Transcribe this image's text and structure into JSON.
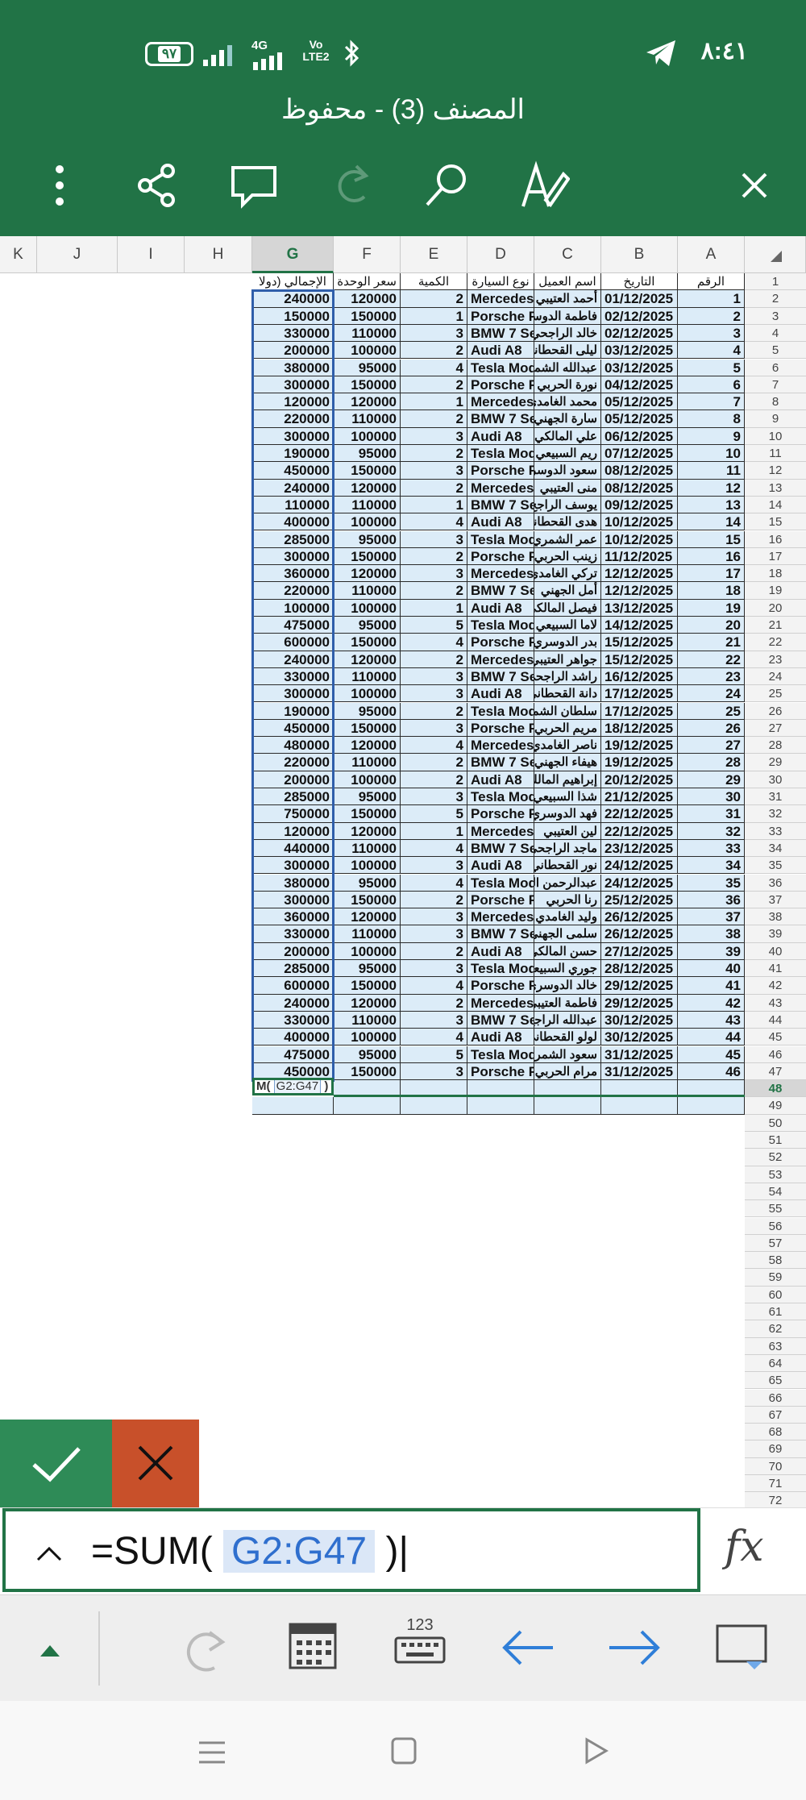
{
  "status_bar": {
    "time": "٨:٤١",
    "battery": "٩٧",
    "network": "4G",
    "volte": "Vo LTE2"
  },
  "header": {
    "title": "المصنف (3) - محفوظ"
  },
  "columns": [
    "K",
    "J",
    "I",
    "H",
    "G",
    "F",
    "E",
    "D",
    "C",
    "B",
    "A"
  ],
  "selected_column": "G",
  "headers": {
    "A": "الرقم",
    "B": "التاريخ",
    "C": "اسم العميل",
    "D": "نوع السيارة",
    "E": "الكمية",
    "F": "سعر الوحدة (",
    "G": "الإجمالي (دولا"
  },
  "rows": [
    [
      "1",
      "01/12/2025",
      "أحمد العتيبي",
      "Mercedes",
      "2",
      "120000",
      "240000"
    ],
    [
      "2",
      "02/12/2025",
      "فاطمة الدوسر",
      "Porsche F",
      "1",
      "150000",
      "150000"
    ],
    [
      "3",
      "02/12/2025",
      "خالد الراجحي",
      "BMW 7 Se",
      "3",
      "110000",
      "330000"
    ],
    [
      "4",
      "03/12/2025",
      "ليلى القحطاني",
      "Audi A8",
      "2",
      "100000",
      "200000"
    ],
    [
      "5",
      "03/12/2025",
      "عبدالله الشمر",
      "Tesla Mod",
      "4",
      "95000",
      "380000"
    ],
    [
      "6",
      "04/12/2025",
      "نورة الحربي",
      "Porsche F",
      "2",
      "150000",
      "300000"
    ],
    [
      "7",
      "05/12/2025",
      "محمد الغامدي",
      "Mercedes",
      "1",
      "120000",
      "120000"
    ],
    [
      "8",
      "05/12/2025",
      "سارة الجهني",
      "BMW 7 Se",
      "2",
      "110000",
      "220000"
    ],
    [
      "9",
      "06/12/2025",
      "علي المالكي",
      "Audi A8",
      "3",
      "100000",
      "300000"
    ],
    [
      "10",
      "07/12/2025",
      "ريم السبيعي",
      "Tesla Mod",
      "2",
      "95000",
      "190000"
    ],
    [
      "11",
      "08/12/2025",
      "سعود الدوسر",
      "Porsche F",
      "3",
      "150000",
      "450000"
    ],
    [
      "12",
      "08/12/2025",
      "منى العتيبي",
      "Mercedes",
      "2",
      "120000",
      "240000"
    ],
    [
      "13",
      "09/12/2025",
      "يوسف الراجح",
      "BMW 7 Se",
      "1",
      "110000",
      "110000"
    ],
    [
      "14",
      "10/12/2025",
      "هدى القحطاني",
      "Audi A8",
      "4",
      "100000",
      "400000"
    ],
    [
      "15",
      "10/12/2025",
      "عمر الشمري",
      "Tesla Mod",
      "3",
      "95000",
      "285000"
    ],
    [
      "16",
      "11/12/2025",
      "زينب الحربي",
      "Porsche F",
      "2",
      "150000",
      "300000"
    ],
    [
      "17",
      "12/12/2025",
      "تركي الغامدي",
      "Mercedes",
      "3",
      "120000",
      "360000"
    ],
    [
      "18",
      "12/12/2025",
      "أمل الجهني",
      "BMW 7 Se",
      "2",
      "110000",
      "220000"
    ],
    [
      "19",
      "13/12/2025",
      "فيصل المالكي",
      "Audi A8",
      "1",
      "100000",
      "100000"
    ],
    [
      "20",
      "14/12/2025",
      "لاما السبيعي",
      "Tesla Mod",
      "5",
      "95000",
      "475000"
    ],
    [
      "21",
      "15/12/2025",
      "بدر الدوسري",
      "Porsche F",
      "4",
      "150000",
      "600000"
    ],
    [
      "22",
      "15/12/2025",
      "جواهر العتيبي",
      "Mercedes",
      "2",
      "120000",
      "240000"
    ],
    [
      "23",
      "16/12/2025",
      "راشد الراجحي",
      "BMW 7 Se",
      "3",
      "110000",
      "330000"
    ],
    [
      "24",
      "17/12/2025",
      "دانة القحطاني",
      "Audi A8",
      "3",
      "100000",
      "300000"
    ],
    [
      "25",
      "17/12/2025",
      "سلطان الشمر",
      "Tesla Mod",
      "2",
      "95000",
      "190000"
    ],
    [
      "26",
      "18/12/2025",
      "مريم الحربي",
      "Porsche F",
      "3",
      "150000",
      "450000"
    ],
    [
      "27",
      "19/12/2025",
      "ناصر الغامدي",
      "Mercedes",
      "4",
      "120000",
      "480000"
    ],
    [
      "28",
      "19/12/2025",
      "هيفاء الجهني",
      "BMW 7 Se",
      "2",
      "110000",
      "220000"
    ],
    [
      "29",
      "20/12/2025",
      "إبراهيم المالك",
      "Audi A8",
      "2",
      "100000",
      "200000"
    ],
    [
      "30",
      "21/12/2025",
      "شذا السبيعي",
      "Tesla Mod",
      "3",
      "95000",
      "285000"
    ],
    [
      "31",
      "22/12/2025",
      "فهد الدوسري",
      "Porsche F",
      "5",
      "150000",
      "750000"
    ],
    [
      "32",
      "22/12/2025",
      "لين العتيبي",
      "Mercedes",
      "1",
      "120000",
      "120000"
    ],
    [
      "33",
      "23/12/2025",
      "ماجد الراجحي",
      "BMW 7 Se",
      "4",
      "110000",
      "440000"
    ],
    [
      "34",
      "24/12/2025",
      "نور القحطاني",
      "Audi A8",
      "3",
      "100000",
      "300000"
    ],
    [
      "35",
      "24/12/2025",
      "عبدالرحمن الش",
      "Tesla Mod",
      "4",
      "95000",
      "380000"
    ],
    [
      "36",
      "25/12/2025",
      "رنا الحربي",
      "Porsche F",
      "2",
      "150000",
      "300000"
    ],
    [
      "37",
      "26/12/2025",
      "وليد الغامدي",
      "Mercedes",
      "3",
      "120000",
      "360000"
    ],
    [
      "38",
      "26/12/2025",
      "سلمى الجهني",
      "BMW 7 Se",
      "3",
      "110000",
      "330000"
    ],
    [
      "39",
      "27/12/2025",
      "حسن المالكي",
      "Audi A8",
      "2",
      "100000",
      "200000"
    ],
    [
      "40",
      "28/12/2025",
      "جوري السبيعي",
      "Tesla Mod",
      "3",
      "95000",
      "285000"
    ],
    [
      "41",
      "29/12/2025",
      "خالد الدوسري",
      "Porsche F",
      "4",
      "150000",
      "600000"
    ],
    [
      "42",
      "29/12/2025",
      "فاطمة العتيبي",
      "Mercedes",
      "2",
      "120000",
      "240000"
    ],
    [
      "43",
      "30/12/2025",
      "عبدالله الراجح",
      "BMW 7 Se",
      "3",
      "110000",
      "330000"
    ],
    [
      "44",
      "30/12/2025",
      "لولو القحطاني",
      "Audi A8",
      "4",
      "100000",
      "400000"
    ],
    [
      "45",
      "31/12/2025",
      "سعود الشمري",
      "Tesla Mod",
      "5",
      "95000",
      "475000"
    ],
    [
      "46",
      "31/12/2025",
      "مرام الحربي",
      "Porsche F",
      "3",
      "150000",
      "450000"
    ]
  ],
  "row_numbers_extra": [
    "48",
    "49",
    "50",
    "51",
    "52",
    "53",
    "54",
    "55",
    "56",
    "57",
    "58",
    "59",
    "60",
    "61",
    "62",
    "63",
    "64",
    "65",
    "66",
    "67",
    "68",
    "69",
    "70",
    "71",
    "72"
  ],
  "editing_cell": {
    "prefix": "M(",
    "ref": "G2:G47",
    "suffix": ")"
  },
  "formula_bar": {
    "prefix": "=SUM(",
    "ref": "G2:G47",
    "suffix": ")",
    "fx": "fx"
  },
  "keyboard_toolbar": {
    "numeric_label": "123"
  },
  "colors": {
    "accent": "#217346",
    "cancel": "#c8502a",
    "ok": "#2e8b57",
    "selection": "#2f5eaa",
    "cell_fill": "#dcecf8"
  }
}
